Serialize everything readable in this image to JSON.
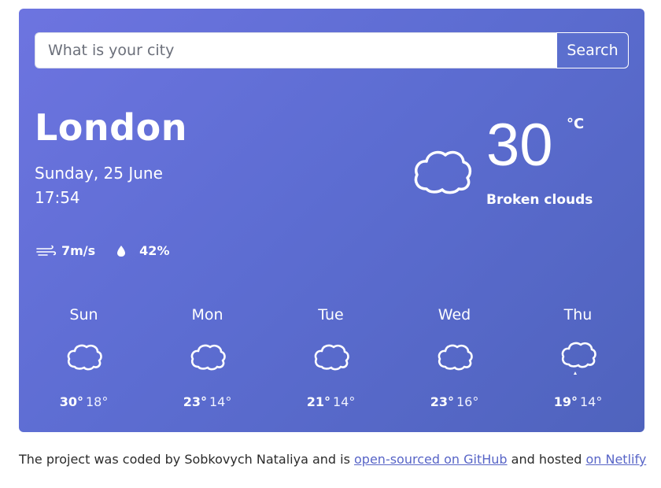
{
  "search": {
    "placeholder": "What is your city",
    "button_label": "Search"
  },
  "current": {
    "city": "London",
    "date": "Sunday, 25 June",
    "time": "17:54",
    "wind": "7m/s",
    "humidity": "42%",
    "temperature": "30",
    "unit": "°C",
    "description": "Broken clouds",
    "icon": "cloud-icon"
  },
  "forecast": [
    {
      "day": "Sun",
      "max": "30°",
      "min": "18°",
      "icon": "cloud-icon"
    },
    {
      "day": "Mon",
      "max": "23°",
      "min": "14°",
      "icon": "cloud-icon"
    },
    {
      "day": "Tue",
      "max": "21°",
      "min": "14°",
      "icon": "cloud-icon"
    },
    {
      "day": "Wed",
      "max": "23°",
      "min": "16°",
      "icon": "cloud-icon"
    },
    {
      "day": "Thu",
      "max": "19°",
      "min": "14°",
      "icon": "rain-cloud-icon"
    }
  ],
  "footer": {
    "text_1": "The project was coded by Sobkovych Nataliya and is ",
    "link_github": "open-sourced on GitHub",
    "text_2": " and hosted ",
    "link_netlify": "on Netlify"
  },
  "colors": {
    "card_gradient_start": "#6d74e0",
    "card_gradient_end": "#4f63bd",
    "link": "#5865c7"
  }
}
